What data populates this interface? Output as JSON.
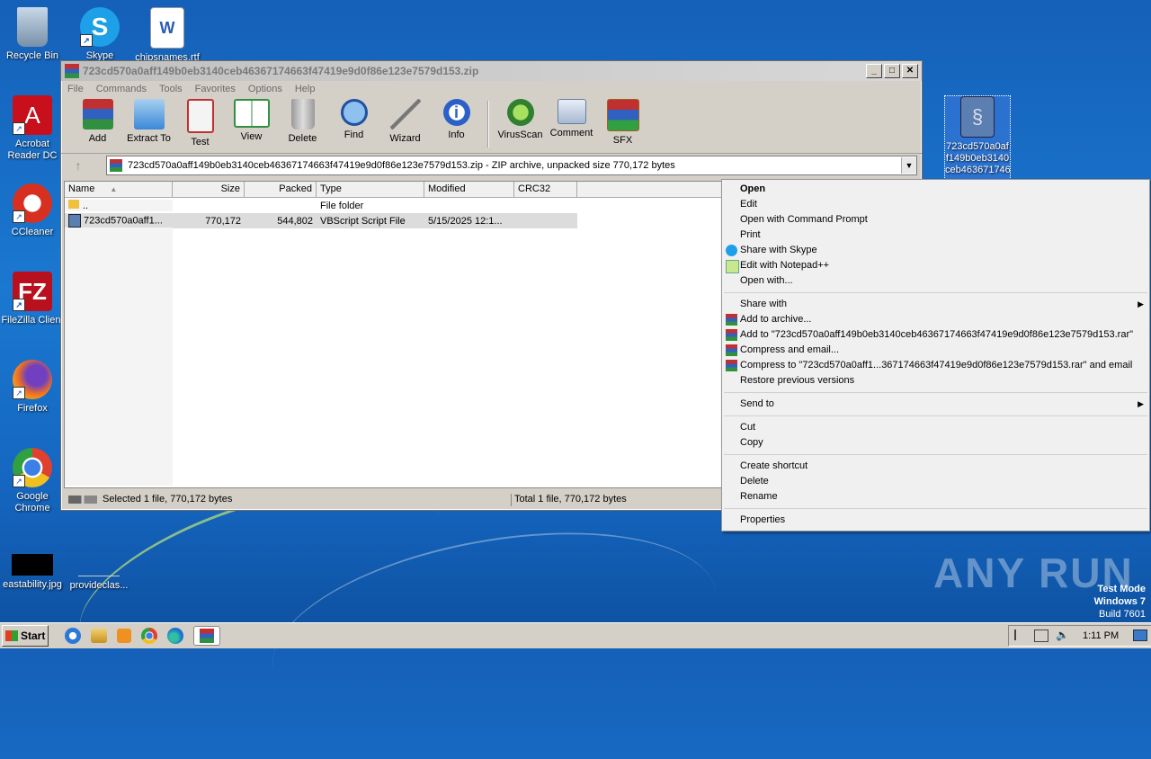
{
  "desktop": {
    "icons": [
      {
        "label": "Recycle Bin"
      },
      {
        "label": "Skype"
      },
      {
        "label": "chipsnames.rtf"
      },
      {
        "label": "Acrobat Reader DC"
      },
      {
        "label": "CCleaner"
      },
      {
        "label": "FileZilla Client"
      },
      {
        "label": "Firefox"
      },
      {
        "label": "Google Chrome"
      },
      {
        "label": "eastability.jpg"
      },
      {
        "label": "provideclas..."
      },
      {
        "label": "723cd570a0af f149b0eb3140 ceb463671746"
      }
    ]
  },
  "window": {
    "title": "723cd570a0aff149b0eb3140ceb46367174663f47419e9d0f86e123e7579d153.zip",
    "menu": [
      "File",
      "Commands",
      "Tools",
      "Favorites",
      "Options",
      "Help"
    ],
    "toolbar": [
      "Add",
      "Extract To",
      "Test",
      "View",
      "Delete",
      "Find",
      "Wizard",
      "Info",
      "VirusScan",
      "Comment",
      "SFX"
    ],
    "address": "723cd570a0aff149b0eb3140ceb46367174663f47419e9d0f86e123e7579d153.zip - ZIP archive, unpacked size 770,172 bytes",
    "columns": [
      "Name",
      "Size",
      "Packed",
      "Type",
      "Modified",
      "CRC32"
    ],
    "rows": [
      {
        "name": "..",
        "size": "",
        "packed": "",
        "type": "File folder",
        "modified": "",
        "crc": ""
      },
      {
        "name": "723cd570a0aff1...",
        "size": "770,172",
        "packed": "544,802",
        "type": "VBScript Script File",
        "modified": "5/15/2025 12:1...",
        "crc": ""
      }
    ],
    "status_left": "Selected 1 file, 770,172 bytes",
    "status_right": "Total 1 file, 770,172 bytes"
  },
  "context_menu": {
    "items": [
      "Open",
      "Edit",
      "Open with Command Prompt",
      "Print",
      "Share with Skype",
      "Edit with Notepad++",
      "Open with...",
      "Share with",
      "Add to archive...",
      "Add to \"723cd570a0aff149b0eb3140ceb46367174663f47419e9d0f86e123e7579d153.rar\"",
      "Compress and email...",
      "Compress to \"723cd570a0aff1...367174663f47419e9d0f86e123e7579d153.rar\" and email",
      "Restore previous versions",
      "Send to",
      "Cut",
      "Copy",
      "Create shortcut",
      "Delete",
      "Rename",
      "Properties"
    ]
  },
  "taskbar": {
    "start": "Start",
    "clock": "1:11 PM"
  },
  "watermark": {
    "line1": "Test Mode",
    "line2": "Windows 7",
    "line3": "Build 7601",
    "brand": "ANY RUN"
  }
}
